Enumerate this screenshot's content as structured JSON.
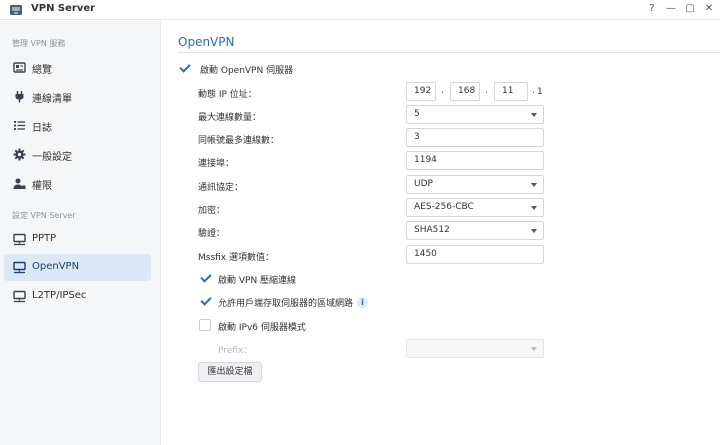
{
  "window": {
    "title": "VPN Server",
    "controls": {
      "help": "?",
      "minimize": "—",
      "maximize": "▢",
      "close": "✕"
    }
  },
  "sidebar": {
    "section1": "管理 VPN 服務",
    "items1": [
      {
        "label": "總覽",
        "icon": "overview-icon"
      },
      {
        "label": "連線清單",
        "icon": "plug-icon"
      },
      {
        "label": "日誌",
        "icon": "list-icon"
      },
      {
        "label": "一般設定",
        "icon": "gear-icon"
      },
      {
        "label": "權限",
        "icon": "user-key-icon"
      }
    ],
    "section2": "設定 VPN Server",
    "items2": [
      {
        "label": "PPTP",
        "icon": "network-icon"
      },
      {
        "label": "OpenVPN",
        "icon": "network-icon",
        "active": true
      },
      {
        "label": "L2TP/IPSec",
        "icon": "network-icon"
      }
    ]
  },
  "main": {
    "title": "OpenVPN",
    "enable_label": "啟動 OpenVPN 伺服器",
    "enable_checked": true,
    "ip_label": "動態 IP 位址：",
    "ip_parts": [
      "192",
      "168",
      "11",
      "1"
    ],
    "fields": {
      "max_conn": {
        "label": "最大連線數量：",
        "value": "5"
      },
      "max_per_account": {
        "label": "同帳號最多連線數：",
        "value": "3"
      },
      "port": {
        "label": "連接埠：",
        "value": "1194"
      },
      "protocol": {
        "label": "通訊協定：",
        "value": "UDP"
      },
      "encryption": {
        "label": "加密：",
        "value": "AES-256-CBC"
      },
      "auth": {
        "label": "驗證：",
        "value": "SHA512"
      },
      "mssfix": {
        "label": "Mssfix 選項數值：",
        "value": "1450"
      }
    },
    "compress_label": "啟動 VPN 壓縮連線",
    "compress_checked": true,
    "lan_label": "允許用戶端存取伺服器的區域網路",
    "lan_checked": true,
    "info_glyph": "i",
    "ipv6_label": "啟動 IPv6 伺服器模式",
    "ipv6_checked": false,
    "prefix_label": "Prefix：",
    "prefix_value": "",
    "export_button": "匯出設定檔"
  },
  "colors": {
    "accent": "#2e6ab1",
    "sidebar_bg": "#f5f6f8",
    "active_bg": "#dde8f6"
  }
}
